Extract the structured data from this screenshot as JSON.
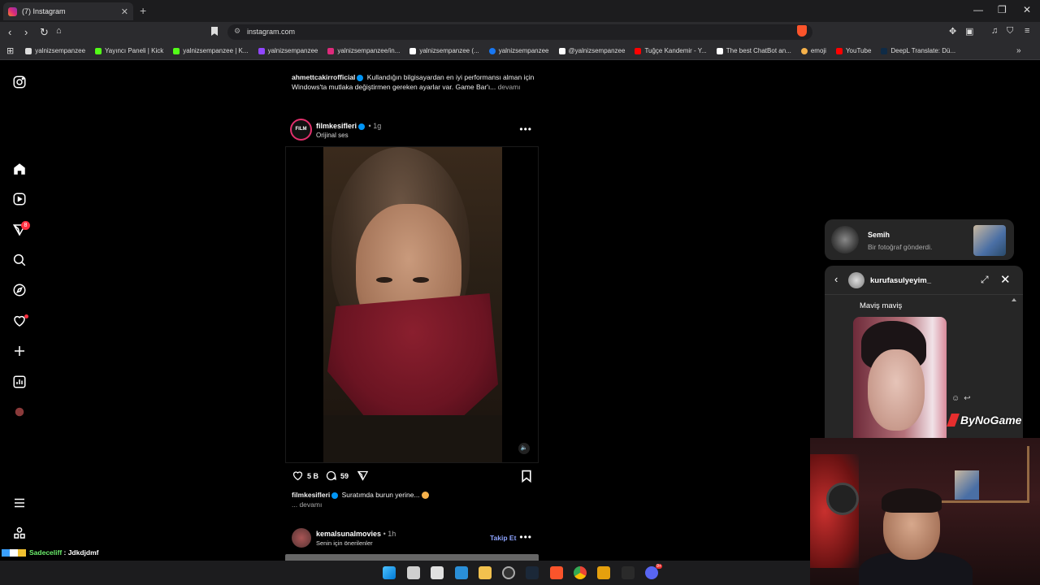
{
  "browser": {
    "tab_title": "(7) Instagram",
    "tab_close": "✕",
    "new_tab": "+",
    "url": "instagram.com",
    "window_controls": [
      "—",
      "❐",
      "✕"
    ]
  },
  "bookmarks": [
    {
      "label": "yalnizsempanzee",
      "color": "#ffffff"
    },
    {
      "label": "Yayıncı Paneli | Kick",
      "color": "#53fc18"
    },
    {
      "label": "yalnizsempanzee | K...",
      "color": "#53fc18"
    },
    {
      "label": "yalnizsempanzee",
      "color": "#9146ff"
    },
    {
      "label": "yalnizsempanzee/in...",
      "color": "#dd2a7b"
    },
    {
      "label": "yalnizsempanzee (...",
      "color": "#ffffff"
    },
    {
      "label": "yalnizsempanzee",
      "color": "#1877f2"
    },
    {
      "label": "@yalnizsempanzee",
      "color": "#ffffff"
    },
    {
      "label": "Tuğçe Kandemir - Y...",
      "color": "#ff0000"
    },
    {
      "label": "The best ChatBot an...",
      "color": "#ffffff"
    },
    {
      "label": "emoji",
      "color": "#f5b14a"
    },
    {
      "label": "YouTube",
      "color": "#ff0000"
    },
    {
      "label": "DeepL Translate: Dü...",
      "color": "#0f2b46"
    }
  ],
  "sidebar": {
    "notification_count": "8"
  },
  "feed": {
    "prev_post": {
      "username": "ahmettcakirrofficial",
      "caption": "Kullandığın bilgisayardan en iyi performansı alman için Windows'ta mutlaka değiştirmen gereken ayarlar var. Game Bar'ı...",
      "more": "devamı"
    },
    "post": {
      "username": "filmkesifleri",
      "avatar_text": "FILM",
      "time": "• 1g",
      "audio": "Orijinal ses",
      "more_menu": "•••",
      "likes": "5 B",
      "comments": "59",
      "caption": "Suratımda burun yerine...",
      "more": "... devamı",
      "mute_icon": "🔈"
    },
    "next_post": {
      "username": "kemalsunalmovies",
      "time": "• 1h",
      "subtitle": "Senin için önerilenler",
      "follow": "Takip Et",
      "more_menu": "•••"
    }
  },
  "notification": {
    "name": "Semih",
    "text": "Bir fotoğraf gönderdi."
  },
  "chat": {
    "username": "kurufasulyeyim_",
    "back": "‹",
    "expand": "⤢",
    "close": "✕",
    "message": "Maviş maviş",
    "react_icons": "☺↩"
  },
  "overlay": {
    "watermark": "ByNoGame",
    "chat_user": "Sadeceliff",
    "chat_text": " : Jdkdjdmf"
  },
  "taskbar": {
    "badge": "9+",
    "icons": [
      "windows-icon",
      "task-view-icon",
      "notes-icon",
      "photos-icon",
      "folder-icon",
      "obs-icon",
      "steam-icon",
      "brave-icon",
      "chrome-icon",
      "plex-icon",
      "epic-games-icon",
      "discord-icon"
    ]
  }
}
